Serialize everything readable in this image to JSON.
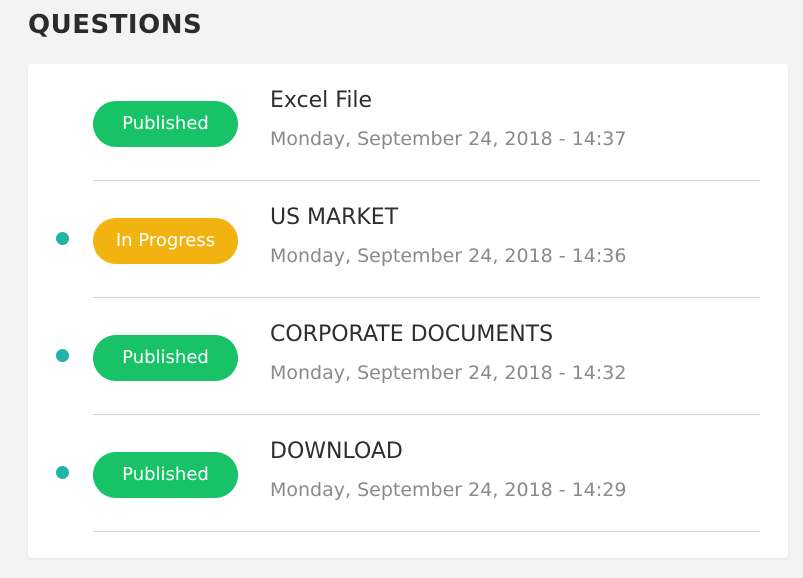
{
  "header": {
    "title": "QUESTIONS"
  },
  "colors": {
    "published": "#18c266",
    "in_progress": "#f2b311",
    "unread_dot": "#21b3a3"
  },
  "questions": [
    {
      "status": "Published",
      "status_type": "published",
      "unread": false,
      "title": "Excel File",
      "date": "Monday, September 24, 2018 - 14:37"
    },
    {
      "status": "In Progress",
      "status_type": "in_progress",
      "unread": true,
      "title": "US MARKET",
      "date": "Monday, September 24, 2018 - 14:36"
    },
    {
      "status": "Published",
      "status_type": "published",
      "unread": true,
      "title": "CORPORATE DOCUMENTS",
      "date": "Monday, September 24, 2018 - 14:32"
    },
    {
      "status": "Published",
      "status_type": "published",
      "unread": true,
      "title": "DOWNLOAD",
      "date": "Monday, September 24, 2018 - 14:29"
    }
  ]
}
